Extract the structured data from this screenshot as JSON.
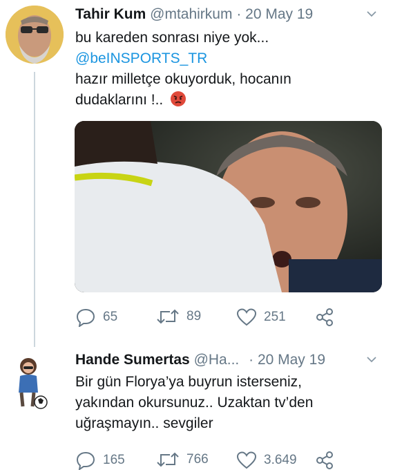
{
  "tweets": [
    {
      "name": "Tahir Kum",
      "handle": "@mtahirkum",
      "separator": "·",
      "date": "20 May 19",
      "lines": [
        "bu kareden sonrası niye yok...",
        "@beINSPORTS_TR",
        "hazır milletçe okuyorduk, hocanın",
        "dudaklarını !.."
      ],
      "emoji": "angry-face",
      "counts": {
        "replies": "65",
        "retweets": "89",
        "likes": "251"
      }
    },
    {
      "name": "Hande Sumertas",
      "handle": "@Ha...",
      "separator": "·",
      "date": "20 May 19",
      "lines": [
        "Bir gün Florya’ya buyrun isterseniz,",
        "yakından okursunuz.. Uzaktan tv’den",
        "uğraşmayın.. sevgiler"
      ],
      "counts": {
        "replies": "165",
        "retweets": "766",
        "likes": "3.649"
      }
    }
  ],
  "icons": [
    "reply-icon",
    "retweet-icon",
    "like-icon",
    "share-icon",
    "chevron-down-icon"
  ],
  "colors": {
    "text": "#14171a",
    "secondary": "#657786",
    "link": "#1b95e0",
    "line": "#ccd6dd"
  }
}
